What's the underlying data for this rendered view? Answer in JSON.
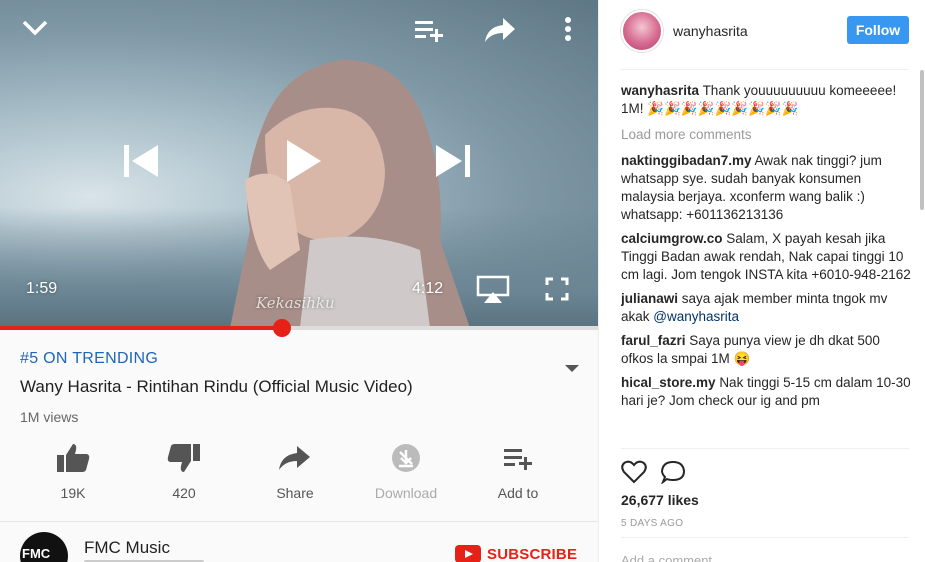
{
  "youtube": {
    "player": {
      "current_time": "1:59",
      "duration": "4:12",
      "progress_fraction": 0.472,
      "watermark": "Kekasihku",
      "icons": [
        "chevron-down-icon",
        "add-to-playlist-icon",
        "share-icon",
        "more-vert-icon",
        "previous-icon",
        "play-icon",
        "next-icon",
        "cast-icon",
        "fullscreen-icon"
      ]
    },
    "info": {
      "trending": "#5 ON TRENDING",
      "title": "Wany Hasrita - Rintihan Rindu (Official Music Video)",
      "views": "1M views"
    },
    "actions": [
      {
        "icon": "thumbs-up-icon",
        "label": "19K"
      },
      {
        "icon": "thumbs-down-icon",
        "label": "420"
      },
      {
        "icon": "share-icon",
        "label": "Share"
      },
      {
        "icon": "download-icon",
        "label": "Download"
      },
      {
        "icon": "add-to-playlist-icon",
        "label": "Add to"
      }
    ],
    "channel": {
      "avatar_text": "FMC",
      "name": "FMC Music",
      "subscribe_label": "SUBSCRIBE"
    },
    "colors": {
      "accent_red": "#e62117",
      "trending_blue": "#1e66b8"
    }
  },
  "instagram": {
    "username": "wanyhasrita",
    "follow_label": "Follow",
    "caption": {
      "user": "wanyhasrita",
      "text": "Thank youuuuuuuuu komeeeee! 1M! 🎉🎉🎉🎉🎉🎉🎉🎉🎉"
    },
    "load_more": "Load more comments",
    "comments": [
      {
        "user": "naktinggibadan7.my",
        "text": "Awak nak tinggi? jum whatsapp sye. sudah banyak konsumen malaysia berjaya. xconferm wang balik :) whatsapp: +601136213136"
      },
      {
        "user": "calciumgrow.co",
        "text": "Salam, X payah kesah jika Tinggi Badan awak rendah, Nak capai tinggi 10 cm lagi. Jom tengok INSTA kita +6010-948-2162"
      },
      {
        "user": "julianawi",
        "text": "saya ajak member minta tngok mv akak",
        "mention": "@wanyhasrita"
      },
      {
        "user": "farul_fazri",
        "text": "Saya punya view je dh dkat 500 ofkos la smpai 1M 😝"
      },
      {
        "user": "hical_store.my",
        "text": "Nak tinggi 5-15 cm dalam 10-30 hari je? Jom check our ig and pm"
      }
    ],
    "likes": "26,677 likes",
    "time_ago": "5 DAYS AGO",
    "add_comment_placeholder": "Add a comment...",
    "colors": {
      "follow_blue": "#3897f0"
    }
  }
}
